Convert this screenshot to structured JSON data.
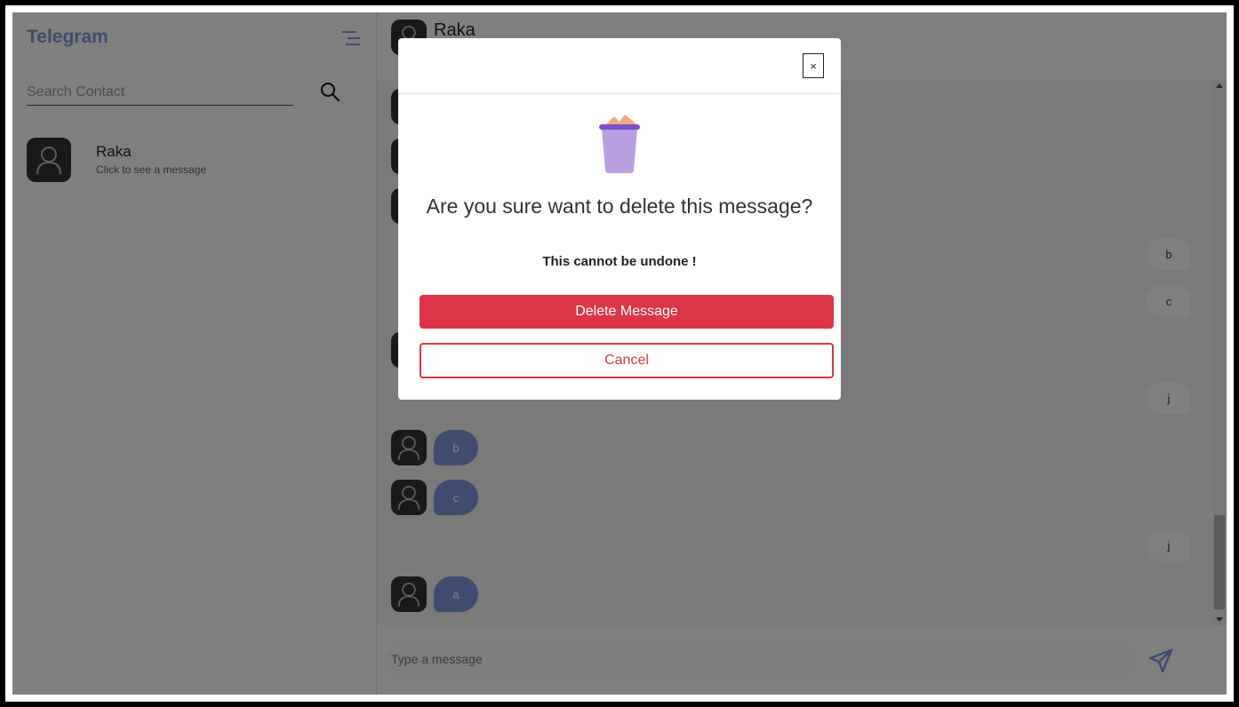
{
  "sidebar": {
    "brand": "Telegram",
    "menu_icon": "menu-icon",
    "search": {
      "placeholder": "Search Contact",
      "icon": "search-icon"
    },
    "contacts": [
      {
        "name": "Raka",
        "preview": "Click to see a message"
      }
    ]
  },
  "chat": {
    "header": {
      "title": "Raka"
    },
    "messages": [
      {
        "side": "in",
        "text": "b"
      },
      {
        "side": "in",
        "text": "c"
      },
      {
        "side": "out",
        "text": "j"
      },
      {
        "side": "in",
        "text": "a"
      }
    ],
    "composer": {
      "placeholder": "Type a message",
      "send_icon": "send-icon"
    }
  },
  "modal": {
    "icon": "trash-icon",
    "close_label": "×",
    "title": "Are you sure want to delete this message?",
    "subtitle": "This cannot be undone !",
    "delete_label": "Delete Message",
    "cancel_label": "Cancel"
  },
  "colors": {
    "brand": "#7e98df",
    "danger": "#dc3545",
    "trash_body": "#b99ee0",
    "trash_rim": "#7b4fc8",
    "trash_paper": "#f2a882"
  }
}
